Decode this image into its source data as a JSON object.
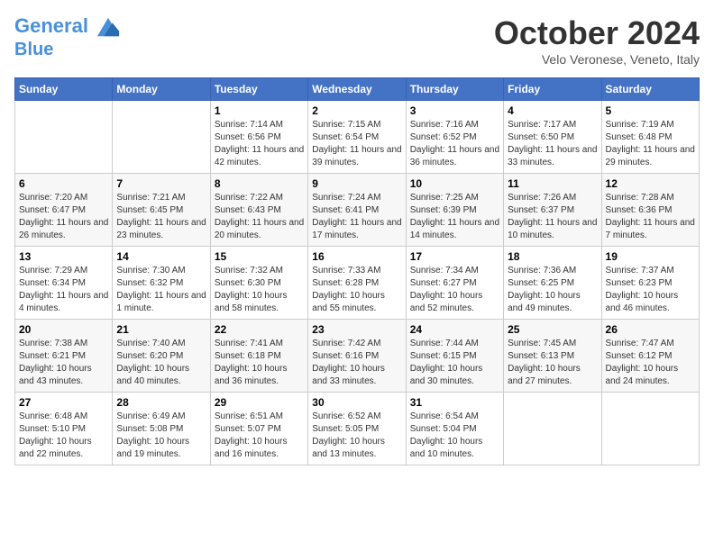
{
  "header": {
    "logo_line1": "General",
    "logo_line2": "Blue",
    "title": "October 2024",
    "location": "Velo Veronese, Veneto, Italy"
  },
  "days_of_week": [
    "Sunday",
    "Monday",
    "Tuesday",
    "Wednesday",
    "Thursday",
    "Friday",
    "Saturday"
  ],
  "weeks": [
    [
      {
        "day": "",
        "info": ""
      },
      {
        "day": "",
        "info": ""
      },
      {
        "day": "1",
        "info": "Sunrise: 7:14 AM\nSunset: 6:56 PM\nDaylight: 11 hours and 42 minutes."
      },
      {
        "day": "2",
        "info": "Sunrise: 7:15 AM\nSunset: 6:54 PM\nDaylight: 11 hours and 39 minutes."
      },
      {
        "day": "3",
        "info": "Sunrise: 7:16 AM\nSunset: 6:52 PM\nDaylight: 11 hours and 36 minutes."
      },
      {
        "day": "4",
        "info": "Sunrise: 7:17 AM\nSunset: 6:50 PM\nDaylight: 11 hours and 33 minutes."
      },
      {
        "day": "5",
        "info": "Sunrise: 7:19 AM\nSunset: 6:48 PM\nDaylight: 11 hours and 29 minutes."
      }
    ],
    [
      {
        "day": "6",
        "info": "Sunrise: 7:20 AM\nSunset: 6:47 PM\nDaylight: 11 hours and 26 minutes."
      },
      {
        "day": "7",
        "info": "Sunrise: 7:21 AM\nSunset: 6:45 PM\nDaylight: 11 hours and 23 minutes."
      },
      {
        "day": "8",
        "info": "Sunrise: 7:22 AM\nSunset: 6:43 PM\nDaylight: 11 hours and 20 minutes."
      },
      {
        "day": "9",
        "info": "Sunrise: 7:24 AM\nSunset: 6:41 PM\nDaylight: 11 hours and 17 minutes."
      },
      {
        "day": "10",
        "info": "Sunrise: 7:25 AM\nSunset: 6:39 PM\nDaylight: 11 hours and 14 minutes."
      },
      {
        "day": "11",
        "info": "Sunrise: 7:26 AM\nSunset: 6:37 PM\nDaylight: 11 hours and 10 minutes."
      },
      {
        "day": "12",
        "info": "Sunrise: 7:28 AM\nSunset: 6:36 PM\nDaylight: 11 hours and 7 minutes."
      }
    ],
    [
      {
        "day": "13",
        "info": "Sunrise: 7:29 AM\nSunset: 6:34 PM\nDaylight: 11 hours and 4 minutes."
      },
      {
        "day": "14",
        "info": "Sunrise: 7:30 AM\nSunset: 6:32 PM\nDaylight: 11 hours and 1 minute."
      },
      {
        "day": "15",
        "info": "Sunrise: 7:32 AM\nSunset: 6:30 PM\nDaylight: 10 hours and 58 minutes."
      },
      {
        "day": "16",
        "info": "Sunrise: 7:33 AM\nSunset: 6:28 PM\nDaylight: 10 hours and 55 minutes."
      },
      {
        "day": "17",
        "info": "Sunrise: 7:34 AM\nSunset: 6:27 PM\nDaylight: 10 hours and 52 minutes."
      },
      {
        "day": "18",
        "info": "Sunrise: 7:36 AM\nSunset: 6:25 PM\nDaylight: 10 hours and 49 minutes."
      },
      {
        "day": "19",
        "info": "Sunrise: 7:37 AM\nSunset: 6:23 PM\nDaylight: 10 hours and 46 minutes."
      }
    ],
    [
      {
        "day": "20",
        "info": "Sunrise: 7:38 AM\nSunset: 6:21 PM\nDaylight: 10 hours and 43 minutes."
      },
      {
        "day": "21",
        "info": "Sunrise: 7:40 AM\nSunset: 6:20 PM\nDaylight: 10 hours and 40 minutes."
      },
      {
        "day": "22",
        "info": "Sunrise: 7:41 AM\nSunset: 6:18 PM\nDaylight: 10 hours and 36 minutes."
      },
      {
        "day": "23",
        "info": "Sunrise: 7:42 AM\nSunset: 6:16 PM\nDaylight: 10 hours and 33 minutes."
      },
      {
        "day": "24",
        "info": "Sunrise: 7:44 AM\nSunset: 6:15 PM\nDaylight: 10 hours and 30 minutes."
      },
      {
        "day": "25",
        "info": "Sunrise: 7:45 AM\nSunset: 6:13 PM\nDaylight: 10 hours and 27 minutes."
      },
      {
        "day": "26",
        "info": "Sunrise: 7:47 AM\nSunset: 6:12 PM\nDaylight: 10 hours and 24 minutes."
      }
    ],
    [
      {
        "day": "27",
        "info": "Sunrise: 6:48 AM\nSunset: 5:10 PM\nDaylight: 10 hours and 22 minutes."
      },
      {
        "day": "28",
        "info": "Sunrise: 6:49 AM\nSunset: 5:08 PM\nDaylight: 10 hours and 19 minutes."
      },
      {
        "day": "29",
        "info": "Sunrise: 6:51 AM\nSunset: 5:07 PM\nDaylight: 10 hours and 16 minutes."
      },
      {
        "day": "30",
        "info": "Sunrise: 6:52 AM\nSunset: 5:05 PM\nDaylight: 10 hours and 13 minutes."
      },
      {
        "day": "31",
        "info": "Sunrise: 6:54 AM\nSunset: 5:04 PM\nDaylight: 10 hours and 10 minutes."
      },
      {
        "day": "",
        "info": ""
      },
      {
        "day": "",
        "info": ""
      }
    ]
  ]
}
